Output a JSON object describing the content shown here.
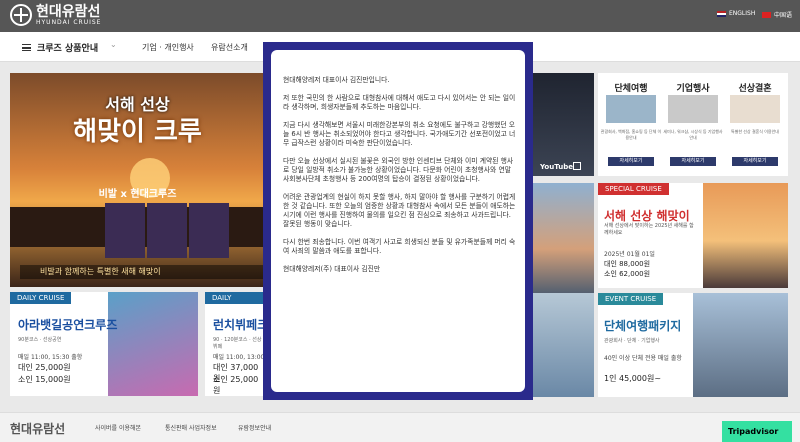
{
  "header": {
    "logo_text": "현대유람선",
    "logo_sub": "HYUNDAI CRUISE",
    "lang_en": "ENGLISH",
    "lang_cn": "中国语"
  },
  "nav": {
    "menu_label": "크루즈 상품안내",
    "links": [
      "기업 · 개인행사",
      "유람선소개"
    ]
  },
  "hero": {
    "line1": "서해 선상",
    "line2": "해맞이 크루",
    "line3": "비발 x 현대크루즈",
    "bar": "비발과 함께하는 특별한 새해 해맞이"
  },
  "daily_cards": [
    {
      "badge": "DAILY CRUISE",
      "title": "아라뱃길공연크루즈",
      "desc": "90분코스 · 선상공연",
      "time": "매일 11:00, 15:30 출항",
      "price1": "대인 25,000원",
      "price2": "소인 15,000원"
    },
    {
      "badge": "DAILY CRUISE",
      "title": "런치뷔페크",
      "desc": "90 · 120분코스 · 선상뷔페",
      "time": "매일 11:00, 13:00",
      "price1": "대인 37,000원",
      "price2": "소인 25,000원"
    }
  ],
  "video": {
    "label": "YouTube"
  },
  "right_top": {
    "columns": [
      {
        "title": "단체여행",
        "desc": "관광회사, 백화점, 홈쇼핑 등 단체 이용안내",
        "button": "자세히보기"
      },
      {
        "title": "기업행사",
        "desc": "세미나, 워크샵, 시상식 등 기업행사 안내",
        "button": "자세히보기"
      },
      {
        "title": "선상결혼",
        "desc": "특별한 선상 결혼식 이용안내",
        "button": "자세히보기"
      }
    ]
  },
  "special": {
    "badge": "SPECIAL CRUISE",
    "title": "서해 선상 해맞이",
    "desc": "서해 선상에서 맞이하는 2025년 새해를 함께하세요",
    "date": "2025년 01월 01일",
    "price1": "대인 88,000원",
    "price2": "소인 62,000원"
  },
  "event": {
    "badge": "EVENT CRUISE",
    "title": "단체여행패키지",
    "desc": "관광회사 · 단체 · 기업행사",
    "detail": "40인 이상 단체 전용 매일 출항",
    "price": "1인 45,000원~"
  },
  "footer": {
    "logo": "현대유람선",
    "links": [
      "사이버를 이용해본",
      "통신판매 사업자정보",
      "유람정보안내"
    ],
    "badge": "Tripadvisor"
  },
  "modal": {
    "paragraphs": [
      "현대해양레저 대표이사 김진만입니다.",
      "저 또한 국민의 한 사람으로 대형참사에 대해서 애도고 다시 있어서는 안 되는 일이라 생각하며, 희생자분들께 추도하는 마음입니다.",
      "지금 다시 생각해보면 서울시 미래한강본부의 취소 요청에도 불구하고 강행했던 오늘 6시 반 행사는 취소되었어야 한다고 생각합니다. 국가애도기간 선포전이었고 너무 급작스런 상황이라 미숙한 판단이었습니다.",
      "다만 오늘 선상에서 실시된 불꽃은 외국인 방한 인센티브 단체와 이미 계약된 행사로 당일 일방적 취소가 불가능한 상황이었습니다. 다문화 어린이 초청행사와 연말 사회봉사단체 초청행사 등 200여명의 탑승이 결정된 상황이었습니다.",
      "어려운 관광업계의 현실이 하지 못할 행사, 하지 말아야 할 행사를 구분하기 어렵게 한 것 같습니다. 또한 오늘의 엄중한 상황과 대형참사 속에서 모든 분들이 애도하는 시기에 이런 행사를 진행하여 물의를 일으킨 점 진심으로 죄송하고 사과드립니다. 잘못된 행동이 맞습니다.",
      "다시 한번 죄송합니다. 이번 여객기 사고로 희생되신 분들 및 유가족분들께 머리 숙여 사죄의 말씀과 애도를 표합니다.",
      "현대해양레저(주) 대표이사 김진만"
    ]
  }
}
